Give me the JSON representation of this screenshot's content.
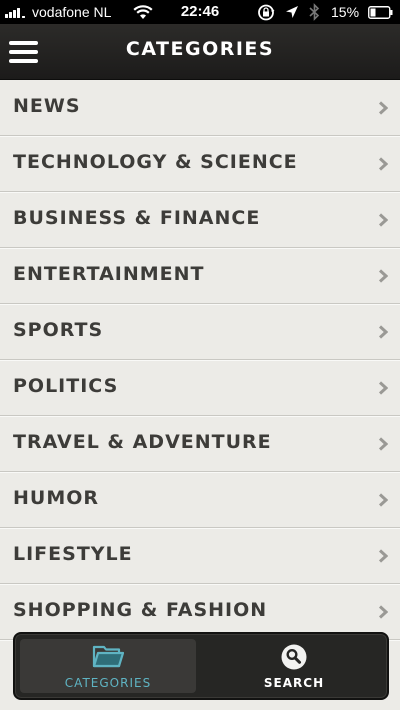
{
  "status_bar": {
    "carrier": "vodafone NL",
    "time": "22:46",
    "battery": "15%"
  },
  "nav": {
    "title": "CATEGORIES",
    "menu_icon": "hamburger-menu-icon"
  },
  "categories": [
    {
      "label": "NEWS"
    },
    {
      "label": "TECHNOLOGY & SCIENCE"
    },
    {
      "label": "BUSINESS & FINANCE"
    },
    {
      "label": "ENTERTAINMENT"
    },
    {
      "label": "SPORTS"
    },
    {
      "label": "POLITICS"
    },
    {
      "label": "TRAVEL & ADVENTURE"
    },
    {
      "label": "HUMOR"
    },
    {
      "label": "LIFESTYLE"
    },
    {
      "label": "SHOPPING & FASHION"
    }
  ],
  "tab_bar": {
    "tabs": [
      {
        "label": "CATEGORIES",
        "icon": "folder-icon",
        "active": true
      },
      {
        "label": "SEARCH",
        "icon": "search-icon",
        "active": false
      }
    ]
  },
  "colors": {
    "accent": "#5fb4c3",
    "background": "#ecebe7",
    "nav_background": "#262624",
    "text": "#3d3c39"
  }
}
